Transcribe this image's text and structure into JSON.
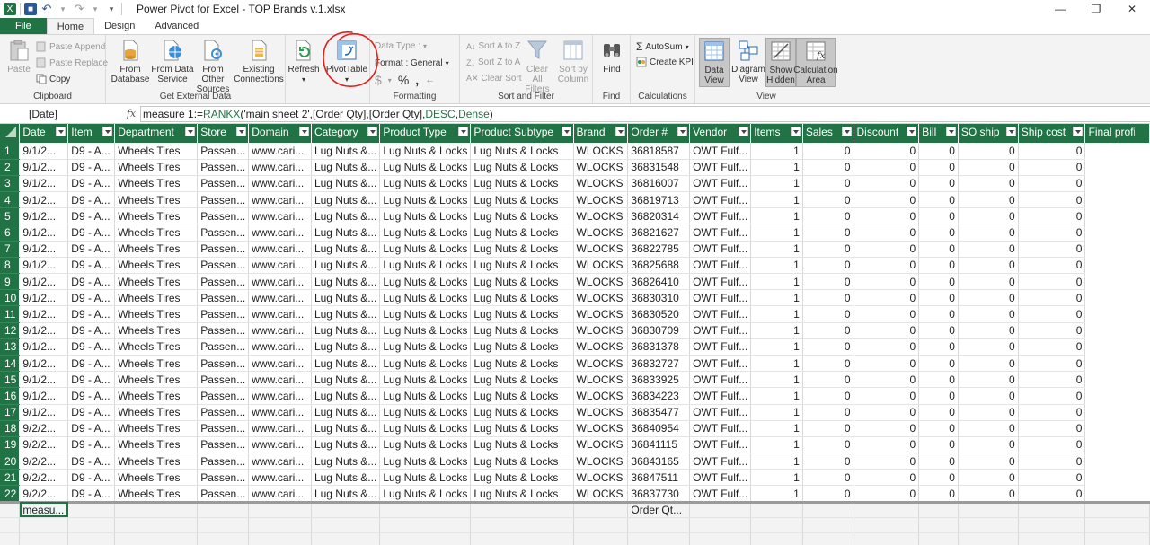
{
  "app": {
    "title": "Power Pivot for Excel - TOP Brands v.1.xlsx",
    "colors": {
      "accent": "#217346",
      "annotation": "#e02020"
    }
  },
  "qat_icons": [
    "excel-icon",
    "save-icon",
    "undo-icon",
    "redo-icon",
    "customize-icon"
  ],
  "window_controls": {
    "minimize": "—",
    "restore": "❐",
    "close": "✕"
  },
  "tabs": [
    "File",
    "Home",
    "Design",
    "Advanced"
  ],
  "ribbon": {
    "clipboard": {
      "paste": "Paste",
      "paste_append": "Paste Append",
      "paste_replace": "Paste Replace",
      "copy": "Copy",
      "label": "Clipboard"
    },
    "external": {
      "from_database": "From Database",
      "from_data_service": "From Data Service",
      "from_other_sources": "From Other Sources",
      "existing_connections": "Existing Connections",
      "label": "Get External Data"
    },
    "refresh": "Refresh",
    "pivot": "PivotTable",
    "formatting": {
      "data_type": "Data Type :",
      "format": "Format : General",
      "currency": "$",
      "percent": "%",
      "comma": ",",
      "label": "Formatting"
    },
    "sort": {
      "sort_az": "Sort A to Z",
      "sort_za": "Sort Z to A",
      "clear_sort": "Clear Sort",
      "clear_filters": "Clear All Filters",
      "sort_by_column": "Sort by Column",
      "label": "Sort and Filter"
    },
    "find": {
      "find": "Find",
      "label": "Find"
    },
    "calculations": {
      "autosum": "AutoSum",
      "create_kpi": "Create KPI",
      "label": "Calculations"
    },
    "view": {
      "data_view": "Data View",
      "diagram_view": "Diagram View",
      "show_hidden": "Show Hidden",
      "calc_area": "Calculation Area",
      "label": "View"
    }
  },
  "formula_bar": {
    "name_box": "[Date]",
    "fx": "fx",
    "prefix": "measure 1:=",
    "func": "RANKX",
    "mid": "('main sheet  2',[Order Qty],[Order Qty],",
    "desc": "DESC",
    "comma": ",",
    "dense": "Dense",
    "suffix": ")"
  },
  "grid": {
    "columns": [
      "Date",
      "Item",
      "Department",
      "Store",
      "Domain",
      "Category",
      "Product Type",
      "Product Subtype",
      "Brand",
      "Order #",
      "Vendor",
      "Items",
      "Sales",
      "Discount",
      "Bill",
      "SO ship",
      "Ship cost",
      "Final profit"
    ],
    "rows": [
      [
        "1",
        "9/1/2...",
        "D9 - A...",
        "Wheels Tires",
        "Passen...",
        "www.cari...",
        "Lug Nuts &...",
        "Lug Nuts & Locks",
        "Lug Nuts & Locks",
        "WLOCKS",
        "36818587",
        "OWT Fulf...",
        "1",
        "0",
        "0",
        "0",
        "0",
        "0"
      ],
      [
        "2",
        "9/1/2...",
        "D9 - A...",
        "Wheels Tires",
        "Passen...",
        "www.cari...",
        "Lug Nuts &...",
        "Lug Nuts & Locks",
        "Lug Nuts & Locks",
        "WLOCKS",
        "36831548",
        "OWT Fulf...",
        "1",
        "0",
        "0",
        "0",
        "0",
        "0"
      ],
      [
        "3",
        "9/1/2...",
        "D9 - A...",
        "Wheels Tires",
        "Passen...",
        "www.cari...",
        "Lug Nuts &...",
        "Lug Nuts & Locks",
        "Lug Nuts & Locks",
        "WLOCKS",
        "36816007",
        "OWT Fulf...",
        "1",
        "0",
        "0",
        "0",
        "0",
        "0"
      ],
      [
        "4",
        "9/1/2...",
        "D9 - A...",
        "Wheels Tires",
        "Passen...",
        "www.cari...",
        "Lug Nuts &...",
        "Lug Nuts & Locks",
        "Lug Nuts & Locks",
        "WLOCKS",
        "36819713",
        "OWT Fulf...",
        "1",
        "0",
        "0",
        "0",
        "0",
        "0"
      ],
      [
        "5",
        "9/1/2...",
        "D9 - A...",
        "Wheels Tires",
        "Passen...",
        "www.cari...",
        "Lug Nuts &...",
        "Lug Nuts & Locks",
        "Lug Nuts & Locks",
        "WLOCKS",
        "36820314",
        "OWT Fulf...",
        "1",
        "0",
        "0",
        "0",
        "0",
        "0"
      ],
      [
        "6",
        "9/1/2...",
        "D9 - A...",
        "Wheels Tires",
        "Passen...",
        "www.cari...",
        "Lug Nuts &...",
        "Lug Nuts & Locks",
        "Lug Nuts & Locks",
        "WLOCKS",
        "36821627",
        "OWT Fulf...",
        "1",
        "0",
        "0",
        "0",
        "0",
        "0"
      ],
      [
        "7",
        "9/1/2...",
        "D9 - A...",
        "Wheels Tires",
        "Passen...",
        "www.cari...",
        "Lug Nuts &...",
        "Lug Nuts & Locks",
        "Lug Nuts & Locks",
        "WLOCKS",
        "36822785",
        "OWT Fulf...",
        "1",
        "0",
        "0",
        "0",
        "0",
        "0"
      ],
      [
        "8",
        "9/1/2...",
        "D9 - A...",
        "Wheels Tires",
        "Passen...",
        "www.cari...",
        "Lug Nuts &...",
        "Lug Nuts & Locks",
        "Lug Nuts & Locks",
        "WLOCKS",
        "36825688",
        "OWT Fulf...",
        "1",
        "0",
        "0",
        "0",
        "0",
        "0"
      ],
      [
        "9",
        "9/1/2...",
        "D9 - A...",
        "Wheels Tires",
        "Passen...",
        "www.cari...",
        "Lug Nuts &...",
        "Lug Nuts & Locks",
        "Lug Nuts & Locks",
        "WLOCKS",
        "36826410",
        "OWT Fulf...",
        "1",
        "0",
        "0",
        "0",
        "0",
        "0"
      ],
      [
        "10",
        "9/1/2...",
        "D9 - A...",
        "Wheels Tires",
        "Passen...",
        "www.cari...",
        "Lug Nuts &...",
        "Lug Nuts & Locks",
        "Lug Nuts & Locks",
        "WLOCKS",
        "36830310",
        "OWT Fulf...",
        "1",
        "0",
        "0",
        "0",
        "0",
        "0"
      ],
      [
        "11",
        "9/1/2...",
        "D9 - A...",
        "Wheels Tires",
        "Passen...",
        "www.cari...",
        "Lug Nuts &...",
        "Lug Nuts & Locks",
        "Lug Nuts & Locks",
        "WLOCKS",
        "36830520",
        "OWT Fulf...",
        "1",
        "0",
        "0",
        "0",
        "0",
        "0"
      ],
      [
        "12",
        "9/1/2...",
        "D9 - A...",
        "Wheels Tires",
        "Passen...",
        "www.cari...",
        "Lug Nuts &...",
        "Lug Nuts & Locks",
        "Lug Nuts & Locks",
        "WLOCKS",
        "36830709",
        "OWT Fulf...",
        "1",
        "0",
        "0",
        "0",
        "0",
        "0"
      ],
      [
        "13",
        "9/1/2...",
        "D9 - A...",
        "Wheels Tires",
        "Passen...",
        "www.cari...",
        "Lug Nuts &...",
        "Lug Nuts & Locks",
        "Lug Nuts & Locks",
        "WLOCKS",
        "36831378",
        "OWT Fulf...",
        "1",
        "0",
        "0",
        "0",
        "0",
        "0"
      ],
      [
        "14",
        "9/1/2...",
        "D9 - A...",
        "Wheels Tires",
        "Passen...",
        "www.cari...",
        "Lug Nuts &...",
        "Lug Nuts & Locks",
        "Lug Nuts & Locks",
        "WLOCKS",
        "36832727",
        "OWT Fulf...",
        "1",
        "0",
        "0",
        "0",
        "0",
        "0"
      ],
      [
        "15",
        "9/1/2...",
        "D9 - A...",
        "Wheels Tires",
        "Passen...",
        "www.cari...",
        "Lug Nuts &...",
        "Lug Nuts & Locks",
        "Lug Nuts & Locks",
        "WLOCKS",
        "36833925",
        "OWT Fulf...",
        "1",
        "0",
        "0",
        "0",
        "0",
        "0"
      ],
      [
        "16",
        "9/1/2...",
        "D9 - A...",
        "Wheels Tires",
        "Passen...",
        "www.cari...",
        "Lug Nuts &...",
        "Lug Nuts & Locks",
        "Lug Nuts & Locks",
        "WLOCKS",
        "36834223",
        "OWT Fulf...",
        "1",
        "0",
        "0",
        "0",
        "0",
        "0"
      ],
      [
        "17",
        "9/1/2...",
        "D9 - A...",
        "Wheels Tires",
        "Passen...",
        "www.cari...",
        "Lug Nuts &...",
        "Lug Nuts & Locks",
        "Lug Nuts & Locks",
        "WLOCKS",
        "36835477",
        "OWT Fulf...",
        "1",
        "0",
        "0",
        "0",
        "0",
        "0"
      ],
      [
        "18",
        "9/2/2...",
        "D9 - A...",
        "Wheels Tires",
        "Passen...",
        "www.cari...",
        "Lug Nuts &...",
        "Lug Nuts & Locks",
        "Lug Nuts & Locks",
        "WLOCKS",
        "36840954",
        "OWT Fulf...",
        "1",
        "0",
        "0",
        "0",
        "0",
        "0"
      ],
      [
        "19",
        "9/2/2...",
        "D9 - A...",
        "Wheels Tires",
        "Passen...",
        "www.cari...",
        "Lug Nuts &...",
        "Lug Nuts & Locks",
        "Lug Nuts & Locks",
        "WLOCKS",
        "36841115",
        "OWT Fulf...",
        "1",
        "0",
        "0",
        "0",
        "0",
        "0"
      ],
      [
        "20",
        "9/2/2...",
        "D9 - A...",
        "Wheels Tires",
        "Passen...",
        "www.cari...",
        "Lug Nuts &...",
        "Lug Nuts & Locks",
        "Lug Nuts & Locks",
        "WLOCKS",
        "36843165",
        "OWT Fulf...",
        "1",
        "0",
        "0",
        "0",
        "0",
        "0"
      ],
      [
        "21",
        "9/2/2...",
        "D9 - A...",
        "Wheels Tires",
        "Passen...",
        "www.cari...",
        "Lug Nuts &...",
        "Lug Nuts & Locks",
        "Lug Nuts & Locks",
        "WLOCKS",
        "36847511",
        "OWT Fulf...",
        "1",
        "0",
        "0",
        "0",
        "0",
        "0"
      ],
      [
        "22",
        "9/2/2...",
        "D9 - A...",
        "Wheels Tires",
        "Passen...",
        "www.cari...",
        "Lug Nuts &...",
        "Lug Nuts & Locks",
        "Lug Nuts & Locks",
        "WLOCKS",
        "36837730",
        "OWT Fulf...",
        "1",
        "0",
        "0",
        "0",
        "0",
        "0"
      ]
    ],
    "calc_area": {
      "date_measure": "measu...",
      "order_measure": "Order Qt..."
    }
  }
}
